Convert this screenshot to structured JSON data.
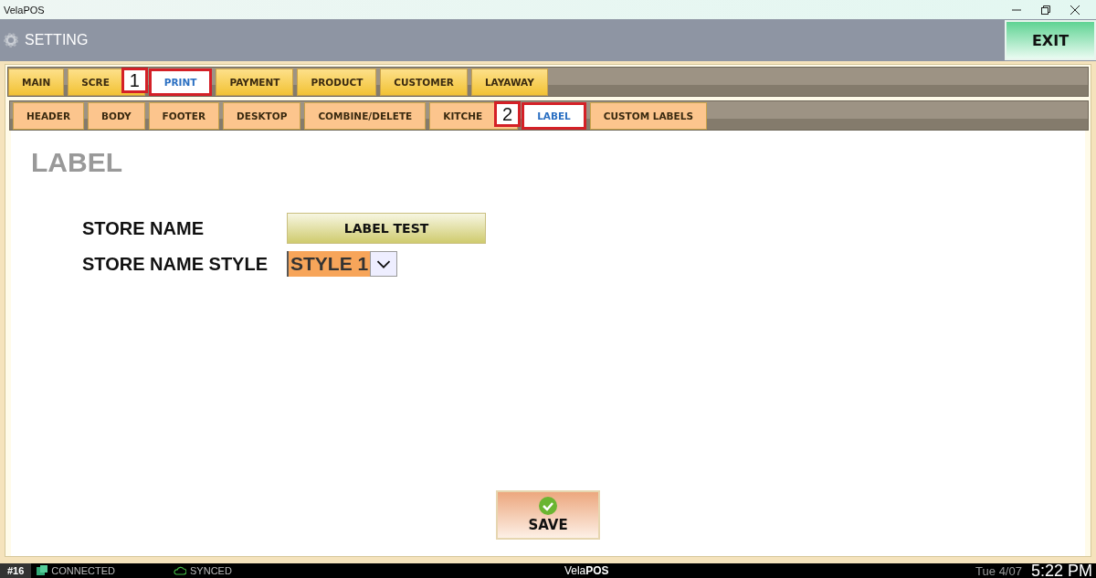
{
  "window": {
    "title": "VelaPOS"
  },
  "header": {
    "title": "SETTING",
    "exit": "EXIT"
  },
  "tabs": [
    {
      "label": "MAIN",
      "selected": false
    },
    {
      "label": "SCRE",
      "selected": false,
      "marker": "1"
    },
    {
      "label": "PRINT",
      "selected": true
    },
    {
      "label": "PAYMENT",
      "selected": false
    },
    {
      "label": "PRODUCT",
      "selected": false
    },
    {
      "label": "CUSTOMER",
      "selected": false
    },
    {
      "label": "LAYAWAY",
      "selected": false
    }
  ],
  "subtabs": [
    {
      "label": "HEADER",
      "selected": false
    },
    {
      "label": "BODY",
      "selected": false
    },
    {
      "label": "FOOTER",
      "selected": false
    },
    {
      "label": "DESKTOP",
      "selected": false
    },
    {
      "label": "COMBINE/DELETE",
      "selected": false
    },
    {
      "label": "KITCHE",
      "selected": false,
      "marker": "2"
    },
    {
      "label": "LABEL",
      "selected": true
    },
    {
      "label": "CUSTOM LABELS",
      "selected": false
    }
  ],
  "section": {
    "title": "LABEL"
  },
  "fields": [
    {
      "kind": "button",
      "label": "STORE NAME",
      "value": "LABEL TEST"
    },
    {
      "kind": "select",
      "label": "STORE NAME STYLE",
      "value": "STYLE 1"
    }
  ],
  "save": "SAVE",
  "status_bar": {
    "terminal": "#16",
    "connection": "CONNECTED",
    "sync": "SYNCED",
    "brand": "Vela**POS**",
    "date": "Tue 4/07",
    "time": "5:22 PM"
  }
}
